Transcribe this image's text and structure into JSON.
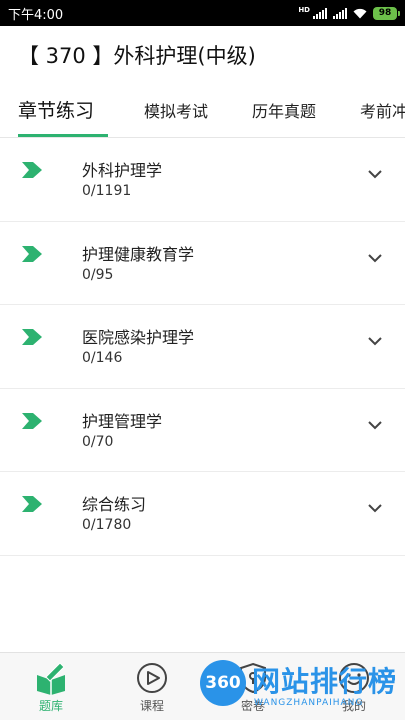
{
  "status_bar": {
    "time": "下午4:00",
    "network": "HD",
    "battery": "98"
  },
  "header": {
    "title": "【 370 】外科护理(中级)"
  },
  "tabs": [
    {
      "label": "章节练习",
      "active": true
    },
    {
      "label": "模拟考试",
      "active": false
    },
    {
      "label": "历年真题",
      "active": false
    },
    {
      "label": "考前冲",
      "active": false
    }
  ],
  "chapters": [
    {
      "name": "外科护理学",
      "progress": "0/1191"
    },
    {
      "name": "护理健康教育学",
      "progress": "0/95"
    },
    {
      "name": "医院感染护理学",
      "progress": "0/146"
    },
    {
      "name": "护理管理学",
      "progress": "0/70"
    },
    {
      "name": "综合练习",
      "progress": "0/1780"
    }
  ],
  "bottom_nav": [
    {
      "label": "题库",
      "icon": "book-pen-icon",
      "active": true
    },
    {
      "label": "课程",
      "icon": "play-circle-icon",
      "active": false
    },
    {
      "label": "密卷",
      "icon": "lock-icon",
      "active": false
    },
    {
      "label": "我的",
      "icon": "smile-icon",
      "active": false
    }
  ],
  "watermark": {
    "badge": "360",
    "text": "网站排行榜",
    "subtext": "WANGZHANPAIHANG"
  },
  "colors": {
    "accent": "#2db270",
    "watermark": "#2a93e8",
    "status_bar": "#000000"
  }
}
